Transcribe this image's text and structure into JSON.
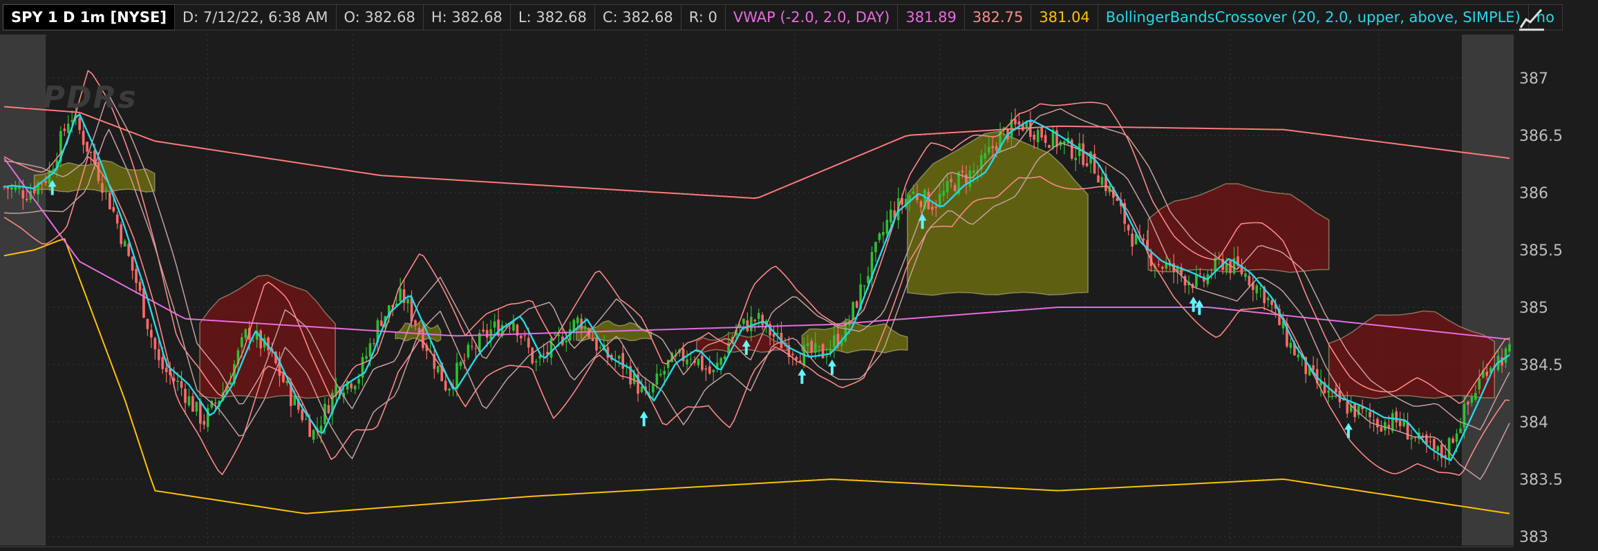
{
  "header": {
    "symbol": "SPY 1 D 1m [NYSE]",
    "date": "D: 7/12/22, 6:38 AM",
    "open": "O: 382.68",
    "high": "H: 382.68",
    "low": "L: 382.68",
    "close": "C: 382.68",
    "range": "R: 0",
    "vwap_label": "VWAP (-2.0, 2.0, DAY)",
    "vwap_value": "381.89",
    "vwap_upper": "382.75",
    "vwap_lower": "381.04",
    "bb_label": "BollingerBandsCrossover (20, 2.0, upper, above, SIMPLE)",
    "bb_value": "no"
  },
  "watermark": "SPDRs",
  "colors": {
    "background": "#1c1c1c",
    "premarket_shade": "#3a3a3a",
    "up_candle": "#2fbf35",
    "down_candle": "#ff6b6b",
    "vwap": "#e86ce0",
    "vwap_upper": "#ff7a7a",
    "vwap_lower": "#ffc107",
    "fast_ma": "#27d8e8",
    "arrow": "#5ff5ff",
    "cloud_bull": "#6b6b10",
    "cloud_bear": "#6a1414",
    "bands": "#ff8888"
  },
  "chart_data": {
    "type": "candlestick",
    "symbol": "SPY",
    "timeframe": "1 D 1m",
    "ylim": [
      383.0,
      387.2
    ],
    "y_ticks": [
      "387",
      "386.5",
      "386",
      "385.5",
      "385",
      "384.5",
      "384",
      "383.5",
      "383"
    ],
    "y_tick_values": [
      387,
      386.5,
      386,
      385.5,
      385,
      384.5,
      384,
      383.5,
      383
    ],
    "grid": true,
    "close_anchors": [
      386.05,
      386.0,
      386.15,
      386.7,
      386.3,
      385.8,
      385.2,
      384.5,
      384.3,
      384.0,
      384.3,
      384.8,
      384.6,
      384.2,
      383.9,
      384.3,
      384.4,
      384.9,
      385.1,
      384.7,
      384.3,
      384.6,
      384.8,
      384.9,
      384.5,
      384.7,
      384.9,
      384.6,
      384.5,
      384.2,
      384.5,
      384.6,
      384.4,
      384.8,
      384.9,
      384.7,
      384.6,
      384.6,
      384.8,
      385.3,
      385.8,
      386.0,
      385.9,
      386.1,
      386.2,
      386.5,
      386.6,
      386.5,
      386.4,
      386.3,
      386.0,
      385.6,
      385.4,
      385.3,
      385.2,
      385.4,
      385.3,
      385.1,
      384.7,
      384.4,
      384.2,
      384.1,
      384.0,
      384.0,
      383.8,
      383.7,
      384.1,
      384.5,
      384.6
    ],
    "vwap": [
      [
        0,
        386.3
      ],
      [
        0.05,
        385.4
      ],
      [
        0.12,
        384.9
      ],
      [
        0.3,
        384.75
      ],
      [
        0.55,
        384.85
      ],
      [
        0.7,
        385.0
      ],
      [
        0.8,
        385.0
      ],
      [
        1.0,
        384.72
      ]
    ],
    "vwap_upper": [
      [
        0,
        386.75
      ],
      [
        0.05,
        386.7
      ],
      [
        0.1,
        386.45
      ],
      [
        0.25,
        386.15
      ],
      [
        0.5,
        385.95
      ],
      [
        0.6,
        386.5
      ],
      [
        0.7,
        386.58
      ],
      [
        0.85,
        386.55
      ],
      [
        1.0,
        386.3
      ]
    ],
    "vwap_lower": [
      [
        0,
        385.45
      ],
      [
        0.02,
        385.5
      ],
      [
        0.04,
        385.6
      ],
      [
        0.08,
        384.2
      ],
      [
        0.1,
        383.4
      ],
      [
        0.2,
        383.2
      ],
      [
        0.35,
        383.35
      ],
      [
        0.55,
        383.5
      ],
      [
        0.7,
        383.4
      ],
      [
        0.85,
        383.5
      ],
      [
        0.95,
        383.3
      ],
      [
        1.0,
        383.2
      ]
    ],
    "signal_arrows": [
      0.032,
      0.425,
      0.493,
      0.53,
      0.55,
      0.61,
      0.79,
      0.794,
      0.893
    ],
    "bull_clouds": [
      [
        0.02,
        0.1,
        386.0,
        386.3
      ],
      [
        0.26,
        0.29,
        384.7,
        384.9
      ],
      [
        0.38,
        0.43,
        384.7,
        384.9
      ],
      [
        0.53,
        0.6,
        384.6,
        384.9
      ],
      [
        0.6,
        0.72,
        385.1,
        386.55
      ]
    ],
    "bear_clouds": [
      [
        0.13,
        0.22,
        384.2,
        385.3
      ],
      [
        0.46,
        0.52,
        384.6,
        384.8
      ],
      [
        0.76,
        0.88,
        385.3,
        386.1
      ],
      [
        0.88,
        0.99,
        384.2,
        385.0
      ]
    ]
  }
}
